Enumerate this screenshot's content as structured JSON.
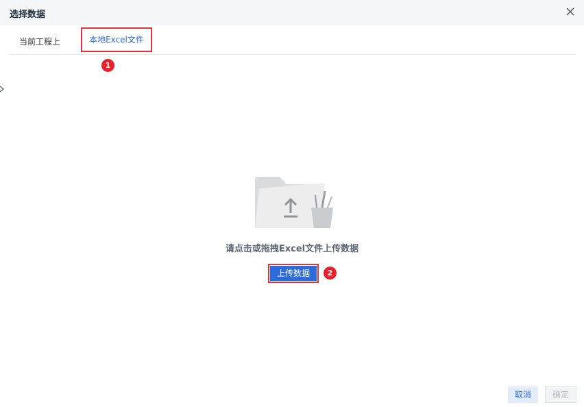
{
  "dialog": {
    "title": "选择数据",
    "close_icon": "close-icon"
  },
  "tabs": [
    {
      "label": "当前工程上",
      "active": false
    },
    {
      "label": "本地Excel文件",
      "active": true
    }
  ],
  "annotations": {
    "marker1": "1",
    "marker2": "2",
    "highlight_color": "#e2323a",
    "marker_color": "#e8212c"
  },
  "upload": {
    "illustration_icon": "folder-upload-icon",
    "hint": "请点击或拖拽Excel文件上传数据",
    "button_label": "上传数据"
  },
  "footer": {
    "cancel_label": "取消",
    "confirm_label": "确定"
  },
  "colors": {
    "accent": "#2f6bd8",
    "header_bg": "#f5f7f9"
  }
}
